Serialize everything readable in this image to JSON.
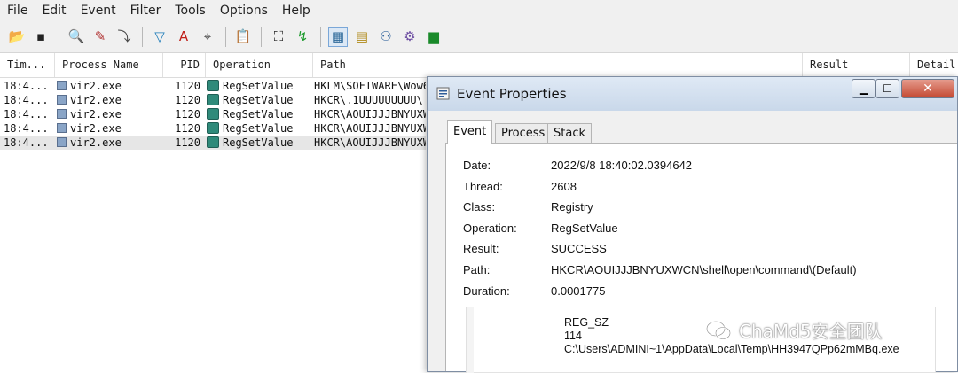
{
  "menu": [
    "File",
    "Edit",
    "Event",
    "Filter",
    "Tools",
    "Options",
    "Help"
  ],
  "toolbar": {
    "icons": [
      {
        "name": "open-icon",
        "glyph": "📂",
        "color": "#c88a1a"
      },
      {
        "name": "save-icon",
        "glyph": "▪",
        "color": "#222222"
      },
      {
        "name": "find-icon",
        "glyph": "🔍",
        "color": "#2f5d9a"
      },
      {
        "name": "highlight-icon",
        "glyph": "✎",
        "color": "#b03030"
      },
      {
        "name": "autoscroll-icon",
        "glyph": "⤵",
        "color": "#444444"
      },
      {
        "name": "filter-icon",
        "glyph": "▽",
        "color": "#1a7ab8"
      },
      {
        "name": "highlight-a-icon",
        "glyph": "A",
        "color": "#c0201a"
      },
      {
        "name": "target-icon",
        "glyph": "⌖",
        "color": "#333333"
      },
      {
        "name": "clipboard-icon",
        "glyph": "📋",
        "color": "#555555"
      },
      {
        "name": "binoculars-icon",
        "glyph": "⛶",
        "color": "#222222"
      },
      {
        "name": "jump-icon",
        "glyph": "↯",
        "color": "#1a9a2a"
      },
      {
        "name": "registry-activity-icon",
        "glyph": "▦",
        "color": "#2f6a9a"
      },
      {
        "name": "file-activity-icon",
        "glyph": "▤",
        "color": "#b08a1a"
      },
      {
        "name": "network-activity-icon",
        "glyph": "⚇",
        "color": "#3a6aa0"
      },
      {
        "name": "process-activity-icon",
        "glyph": "⚙",
        "color": "#6a4aa0"
      },
      {
        "name": "profiling-icon",
        "glyph": "▆",
        "color": "#1a8a2a"
      }
    ]
  },
  "columns": [
    "Tim...",
    "Process Name",
    "PID",
    "Operation",
    "Path",
    "Result",
    "Detail"
  ],
  "rows": [
    {
      "time": "18:4...",
      "process": "vir2.exe",
      "pid": "1120",
      "operation": "RegSetValue",
      "path": "HKLM\\SOFTWARE\\Wow6"
    },
    {
      "time": "18:4...",
      "process": "vir2.exe",
      "pid": "1120",
      "operation": "RegSetValue",
      "path": "HKCR\\.1UUUUUUUUU\\"
    },
    {
      "time": "18:4...",
      "process": "vir2.exe",
      "pid": "1120",
      "operation": "RegSetValue",
      "path": "HKCR\\AOUIJJJBNYUXW"
    },
    {
      "time": "18:4...",
      "process": "vir2.exe",
      "pid": "1120",
      "operation": "RegSetValue",
      "path": "HKCR\\AOUIJJJBNYUXW"
    },
    {
      "time": "18:4...",
      "process": "vir2.exe",
      "pid": "1120",
      "operation": "RegSetValue",
      "path": "HKCR\\AOUIJJJBNYUXW"
    }
  ],
  "dialog": {
    "title": "Event Properties",
    "close_glyph": "✕",
    "min_glyph": "▁",
    "max_glyph": "☐",
    "tabs": [
      "Event",
      "Process",
      "Stack"
    ],
    "fields": [
      {
        "label": "Date:",
        "value": "2022/9/8 18:40:02.0394642"
      },
      {
        "label": "Thread:",
        "value": "2608"
      },
      {
        "label": "Class:",
        "value": "Registry"
      },
      {
        "label": "Operation:",
        "value": "RegSetValue"
      },
      {
        "label": "Result:",
        "value": "SUCCESS"
      },
      {
        "label": "Path:",
        "value": "HKCR\\AOUIJJJBNYUXWCN\\shell\\open\\command\\(Default)"
      },
      {
        "label": "Duration:",
        "value": "0.0001775"
      }
    ],
    "detail": {
      "type": "REG_SZ",
      "length": "114",
      "data": "C:\\Users\\ADMINI~1\\AppData\\Local\\Temp\\HH3947QPp62mMBq.exe"
    }
  },
  "watermark": "ChaMd5安全团队"
}
